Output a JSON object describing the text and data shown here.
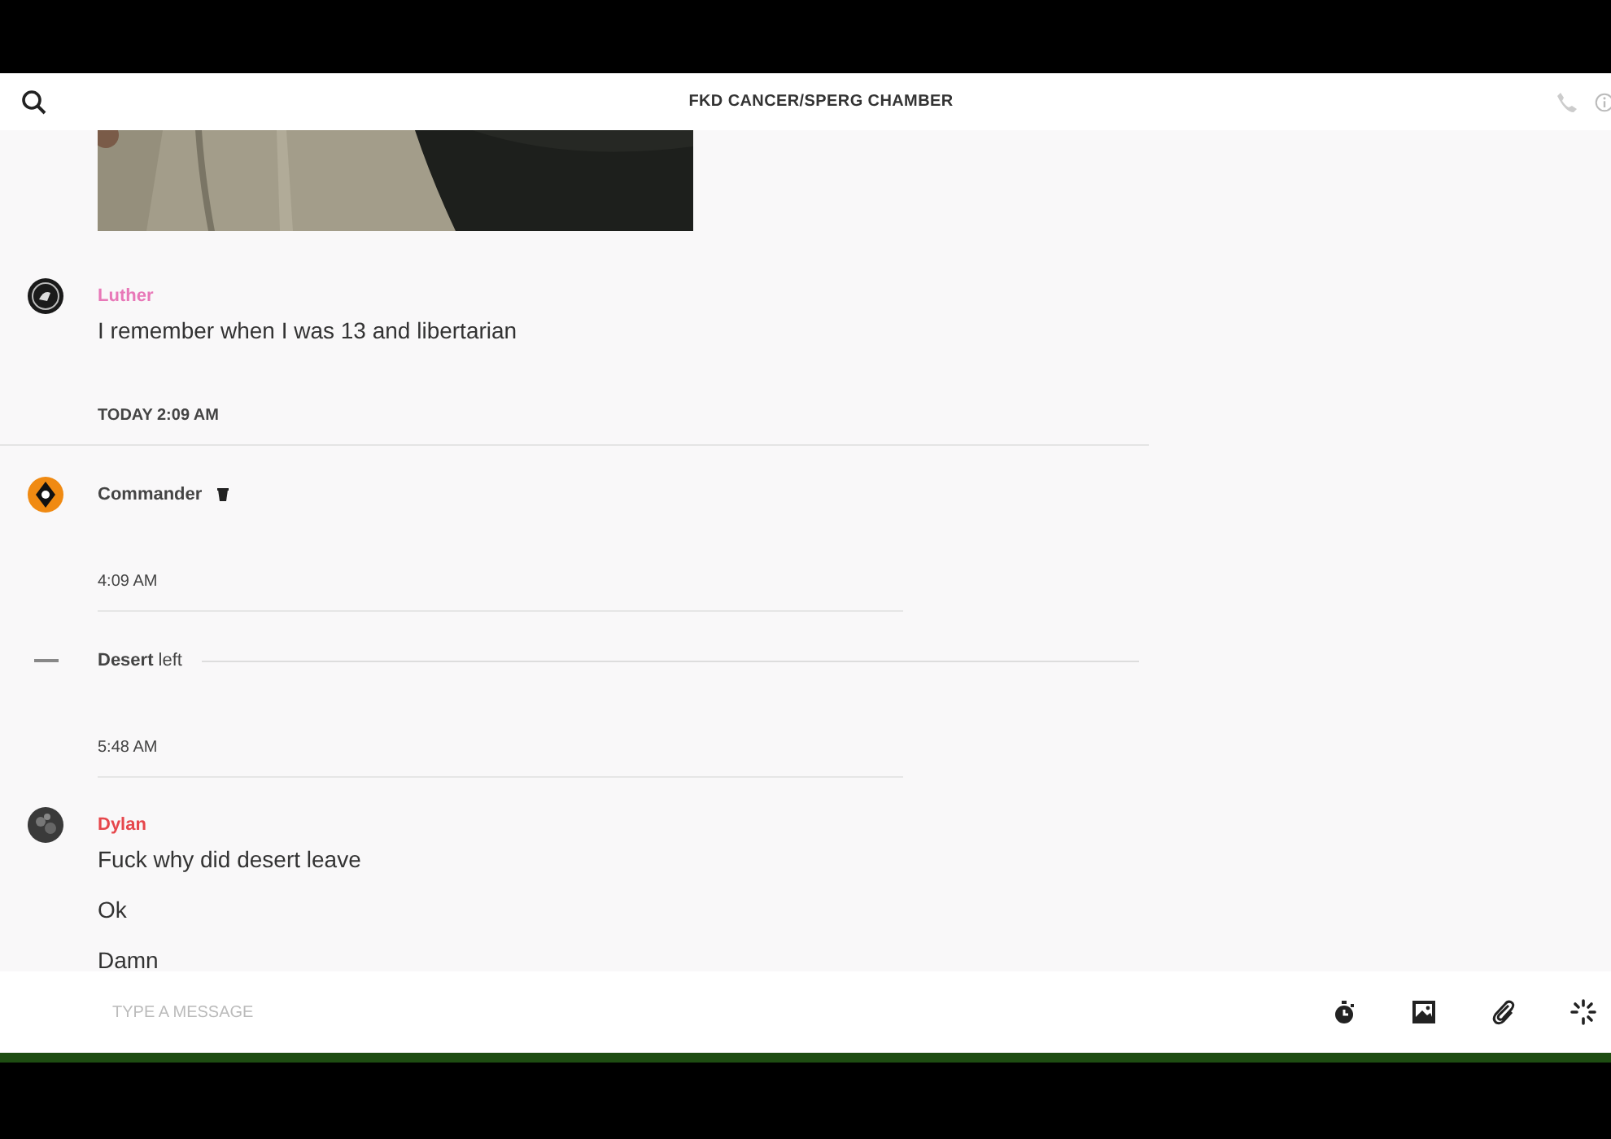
{
  "header": {
    "title": "FKD CANCER/SPERG CHAMBER"
  },
  "feed": [
    {
      "kind": "picture"
    },
    {
      "kind": "message",
      "author": "Luther",
      "color": "#e878b8",
      "badge": false,
      "lines": [
        "I remember when I was 13 and libertarian"
      ]
    },
    {
      "kind": "date_divider",
      "text": "TODAY 2:09 AM"
    },
    {
      "kind": "message",
      "author": "Commander",
      "color": "#444444",
      "badge": true
    },
    {
      "kind": "time_divider",
      "text": "4:09 AM"
    },
    {
      "kind": "leave_event",
      "who": "Desert",
      "action": "left"
    },
    {
      "kind": "time_divider",
      "text": "5:48 AM"
    },
    {
      "kind": "message",
      "author": "Dylan",
      "color": "#e6474c",
      "badge": false,
      "lines": [
        "Fuck why did desert leave",
        "Ok",
        "Damn"
      ]
    }
  ],
  "composer": {
    "placeholder": "TYPE A MESSAGE"
  }
}
